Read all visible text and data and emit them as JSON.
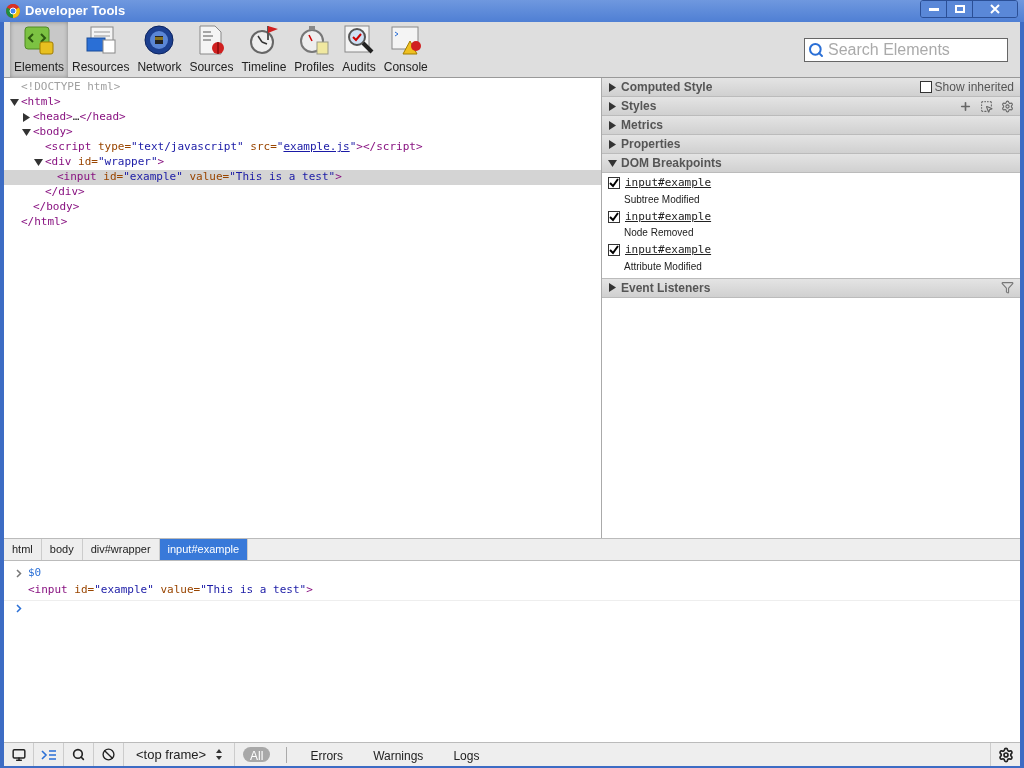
{
  "window": {
    "title": "Developer Tools"
  },
  "toolbar": {
    "tabs": [
      {
        "label": "Elements",
        "selected": true
      },
      {
        "label": "Resources",
        "selected": false
      },
      {
        "label": "Network",
        "selected": false
      },
      {
        "label": "Sources",
        "selected": false
      },
      {
        "label": "Timeline",
        "selected": false
      },
      {
        "label": "Profiles",
        "selected": false
      },
      {
        "label": "Audits",
        "selected": false
      },
      {
        "label": "Console",
        "selected": false
      }
    ],
    "search": {
      "placeholder": "Search Elements"
    }
  },
  "dom_tree": [
    {
      "tokens": [
        {
          "kind": "doctype",
          "text": "<!DOCTYPE html>"
        }
      ],
      "selected": false
    },
    {
      "tokens": [
        {
          "kind": "tag",
          "text": "<html>"
        }
      ],
      "expanded": true,
      "selected": false,
      "children": [
        {
          "tokens": [
            {
              "kind": "tag",
              "text": "<head>"
            },
            {
              "kind": "text",
              "text": "…"
            },
            {
              "kind": "tag",
              "text": "</head>"
            }
          ],
          "expanded": false,
          "selected": false
        },
        {
          "tokens": [
            {
              "kind": "tag",
              "text": "<body>"
            }
          ],
          "expanded": true,
          "selected": false,
          "children": [
            {
              "tokens": [
                {
                  "kind": "tag",
                  "text": "<script"
                },
                {
                  "kind": "attr",
                  "text": " type="
                },
                {
                  "kind": "value",
                  "text": "\"text/javascript\""
                },
                {
                  "kind": "attr",
                  "text": " src="
                },
                {
                  "kind": "value",
                  "text": "\""
                },
                {
                  "kind": "link",
                  "text": "example.js"
                },
                {
                  "kind": "value",
                  "text": "\""
                },
                {
                  "kind": "tag",
                  "text": "></script>"
                }
              ],
              "selected": false
            },
            {
              "tokens": [
                {
                  "kind": "tag",
                  "text": "<div"
                },
                {
                  "kind": "attr",
                  "text": " id="
                },
                {
                  "kind": "value",
                  "text": "\"wrapper\""
                },
                {
                  "kind": "tag",
                  "text": ">"
                }
              ],
              "expanded": true,
              "selected": false,
              "children": [
                {
                  "tokens": [
                    {
                      "kind": "tag",
                      "text": "<input"
                    },
                    {
                      "kind": "attr",
                      "text": " id="
                    },
                    {
                      "kind": "value",
                      "text": "\"example\""
                    },
                    {
                      "kind": "attr",
                      "text": " value="
                    },
                    {
                      "kind": "value",
                      "text": "\"This is a test\""
                    },
                    {
                      "kind": "tag",
                      "text": ">"
                    }
                  ],
                  "selected": true
                }
              ],
              "close": "</div>"
            }
          ],
          "close": "</body>"
        }
      ],
      "close": "</html>"
    }
  ],
  "sidebar": [
    {
      "title": "Computed Style",
      "expanded": false,
      "option": {
        "label": "Show inherited",
        "checked": false
      }
    },
    {
      "title": "Styles",
      "expanded": false,
      "tools": true
    },
    {
      "title": "Metrics",
      "expanded": false
    },
    {
      "title": "Properties",
      "expanded": false
    },
    {
      "title": "DOM Breakpoints",
      "expanded": true,
      "breakpoints": [
        {
          "target": "input#example",
          "type": "Subtree Modified",
          "checked": true
        },
        {
          "target": "input#example",
          "type": "Node Removed",
          "checked": true
        },
        {
          "target": "input#example",
          "type": "Attribute Modified",
          "checked": true
        }
      ]
    },
    {
      "title": "Event Listeners",
      "expanded": false,
      "filter": true
    }
  ],
  "breadcrumbs": [
    {
      "label": "html",
      "selected": false
    },
    {
      "label": "body",
      "selected": false
    },
    {
      "label": "div#wrapper",
      "selected": false
    },
    {
      "label": "input#example",
      "selected": true
    }
  ],
  "console": {
    "command": "$0",
    "result": [
      {
        "kind": "tag",
        "text": "<input"
      },
      {
        "kind": "attr",
        "text": " id="
      },
      {
        "kind": "value",
        "text": "\"example\""
      },
      {
        "kind": "attr",
        "text": " value="
      },
      {
        "kind": "value",
        "text": "\"This is a test\""
      },
      {
        "kind": "tag",
        "text": ">"
      }
    ]
  },
  "status_bar": {
    "frame": "<top frame>",
    "filters": [
      {
        "label": "All",
        "selected": true
      },
      {
        "label": "Errors",
        "selected": false
      },
      {
        "label": "Warnings",
        "selected": false
      },
      {
        "label": "Logs",
        "selected": false
      }
    ]
  }
}
